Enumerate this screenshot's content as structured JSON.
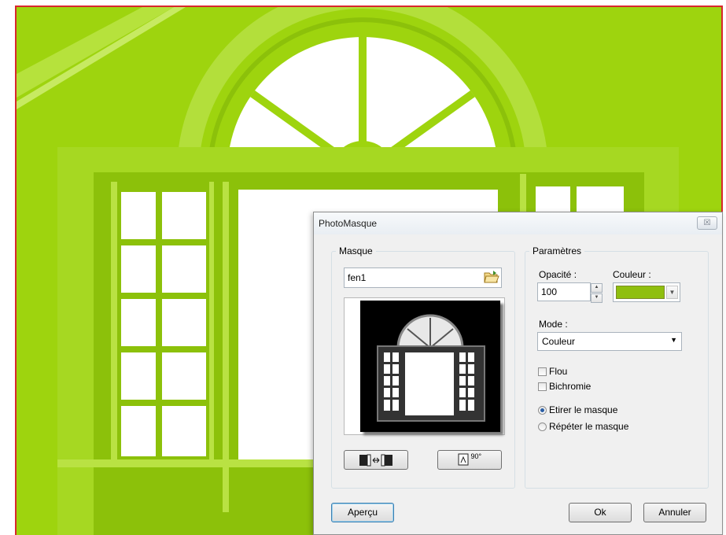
{
  "dialog": {
    "title": "PhotoMasque",
    "close_glyph": "☒"
  },
  "mask_group": {
    "label": "Masque",
    "mask_name": "fen1",
    "folder_icon": "folder-open-icon",
    "flip_icon": "flip-horizontal-icon",
    "rotate_icon": "rotate-90-icon",
    "rotate_text": "90°"
  },
  "params_group": {
    "label": "Paramètres",
    "opacity_label": "Opacité :",
    "opacity_value": "100",
    "color_label": "Couleur :",
    "color_value": "#8fbf0e",
    "mode_label": "Mode :",
    "mode_value": "Couleur",
    "blur_label": "Flou",
    "blur_checked": false,
    "bichromie_label": "Bichromie",
    "bichromie_checked": false,
    "stretch_label": "Etirer le masque",
    "stretch_selected": true,
    "repeat_label": "Répéter le masque",
    "repeat_selected": false
  },
  "footer": {
    "preview_label": "Aperçu",
    "ok_label": "Ok",
    "cancel_label": "Annuler"
  },
  "colors": {
    "mask_green": "#9dd30f",
    "frame_red": "#d8272d"
  }
}
